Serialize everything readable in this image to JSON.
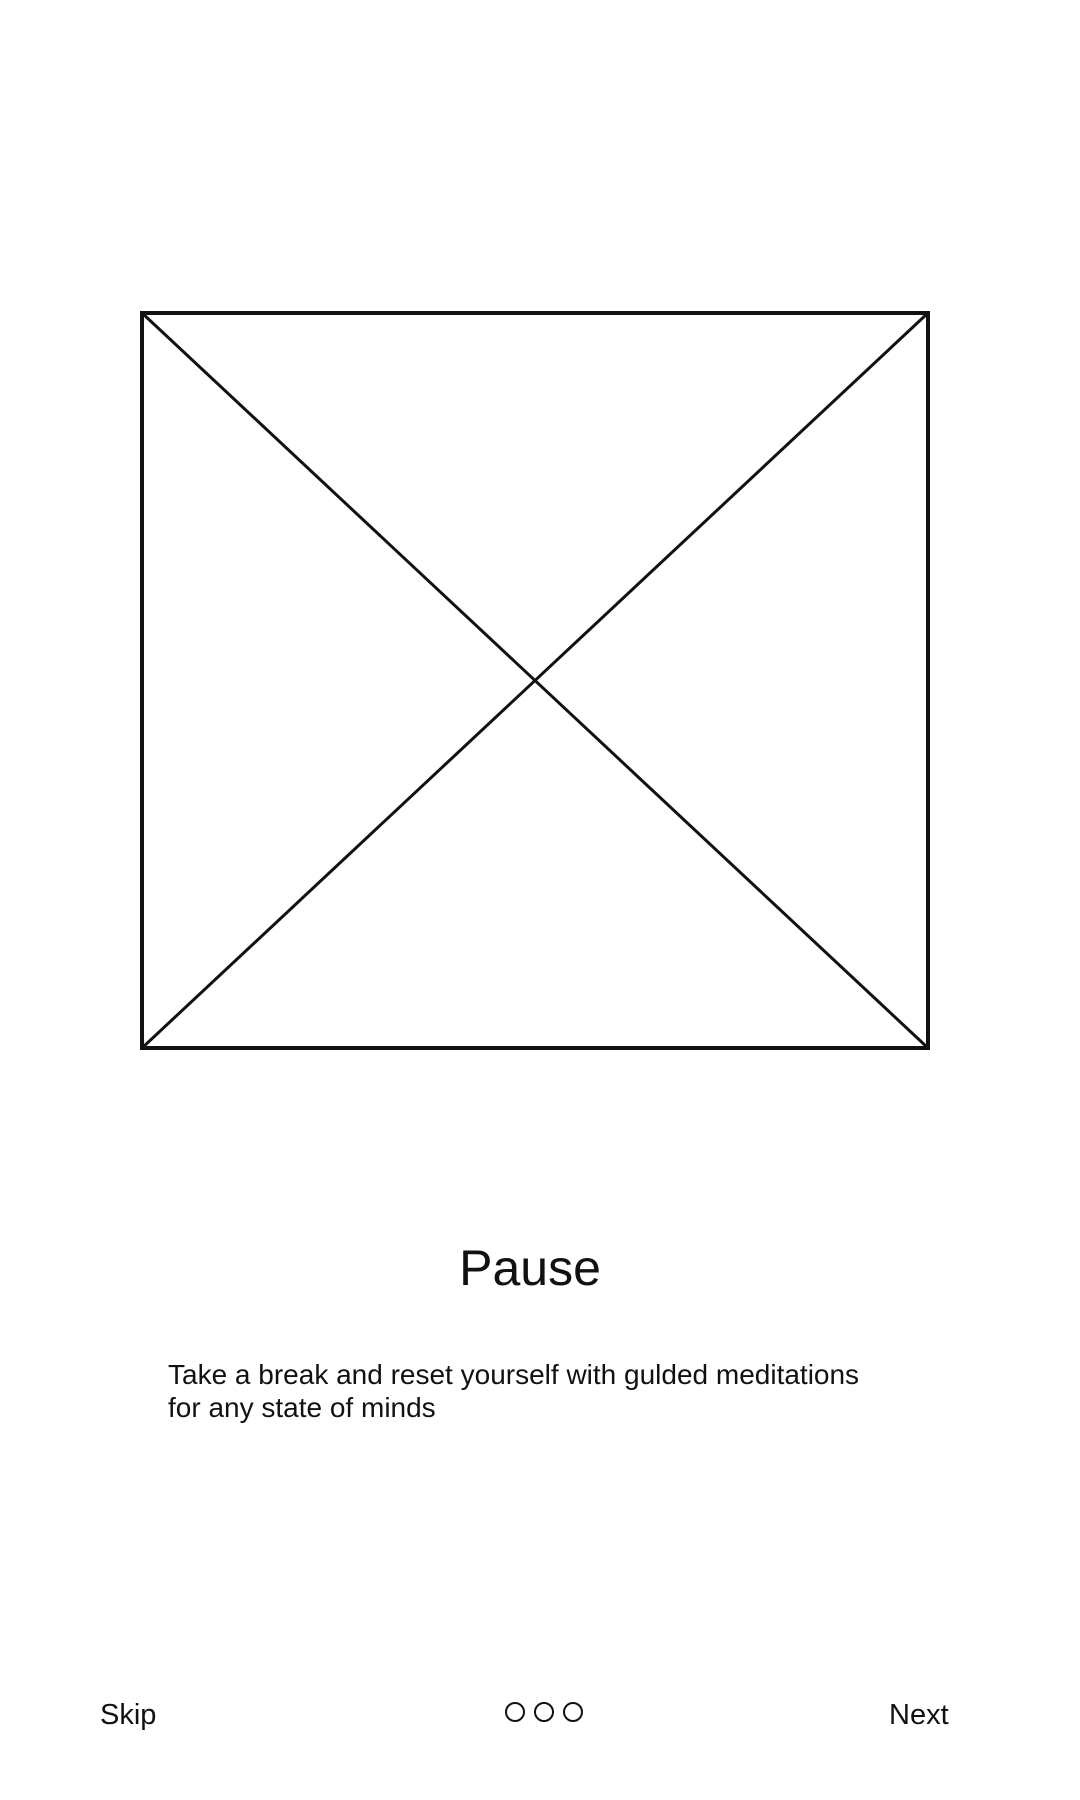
{
  "onboarding": {
    "title": "Pause",
    "description_line1": "Take a break and reset yourself with gulded meditations",
    "description_line2": "for any state of minds",
    "image_icon": "image-placeholder-icon"
  },
  "footer": {
    "skip_label": "Skip",
    "next_label": "Next",
    "page_count": 3
  },
  "colors": {
    "background": "#ffffff",
    "foreground": "#111111"
  }
}
